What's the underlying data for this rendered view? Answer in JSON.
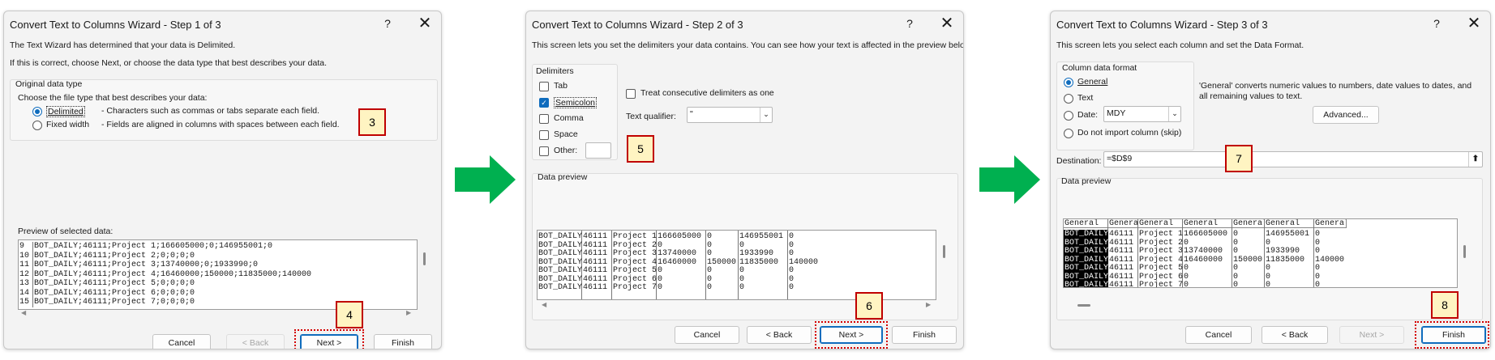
{
  "step1": {
    "title": "Convert Text to Columns Wizard - Step 1 of 3",
    "help": "?",
    "close": "✕",
    "intro1": "The Text Wizard has determined that your data is Delimited.",
    "intro2": "If this is correct, choose Next, or choose the data type that best describes your data.",
    "group_label": "Original data type",
    "choose_label": "Choose the file type that best describes your data:",
    "opt_delimited": "Delimited",
    "opt_delimited_desc": "- Characters such as commas or tabs separate each field.",
    "opt_fixed": "Fixed width",
    "opt_fixed_desc": "- Fields are aligned in columns with spaces between each field.",
    "preview_label": "Preview of selected data:",
    "preview_rows": [
      {
        "n": "9",
        "text": "BOT_DAILY;46111;Project 1;166605000;0;146955001;0"
      },
      {
        "n": "10",
        "text": "BOT_DAILY;46111;Project 2;0;0;0;0"
      },
      {
        "n": "11",
        "text": "BOT_DAILY;46111;Project 3;13740000;0;1933990;0"
      },
      {
        "n": "12",
        "text": "BOT_DAILY;46111;Project 4;16460000;150000;11835000;140000"
      },
      {
        "n": "13",
        "text": "BOT_DAILY;46111;Project 5;0;0;0;0"
      },
      {
        "n": "14",
        "text": "BOT_DAILY;46111;Project 6;0;0;0;0"
      },
      {
        "n": "15",
        "text": "BOT_DAILY;46111;Project 7;0;0;0;0"
      }
    ],
    "btn_cancel": "Cancel",
    "btn_back": "< Back",
    "btn_next": "Next >",
    "btn_finish": "Finish",
    "badge_group": "3",
    "badge_next": "4"
  },
  "step2": {
    "title": "Convert Text to Columns Wizard - Step 2 of 3",
    "help": "?",
    "close": "✕",
    "intro": "This screen lets you set the delimiters your data contains.  You can see how your text is affected in the preview below.",
    "delim_label": "Delimiters",
    "tab": "Tab",
    "semicolon": "Semicolon",
    "comma": "Comma",
    "space": "Space",
    "other": "Other:",
    "consecutive": "Treat consecutive delimiters as one",
    "qualifier_label": "Text qualifier:",
    "qualifier_value": "\"",
    "preview_label": "Data preview",
    "preview_rows": [
      [
        "BOT_DAILY",
        "46111",
        "Project 1",
        "166605000",
        "0",
        "146955001",
        "0"
      ],
      [
        "BOT_DAILY",
        "46111",
        "Project 2",
        "0",
        "0",
        "0",
        "0"
      ],
      [
        "BOT_DAILY",
        "46111",
        "Project 3",
        "13740000",
        "0",
        "1933990",
        "0"
      ],
      [
        "BOT_DAILY",
        "46111",
        "Project 4",
        "16460000",
        "150000",
        "11835000",
        "140000"
      ],
      [
        "BOT_DAILY",
        "46111",
        "Project 5",
        "0",
        "0",
        "0",
        "0"
      ],
      [
        "BOT_DAILY",
        "46111",
        "Project 6",
        "0",
        "0",
        "0",
        "0"
      ],
      [
        "BOT_DAILY",
        "46111",
        "Project 7",
        "0",
        "0",
        "0",
        "0"
      ]
    ],
    "btn_cancel": "Cancel",
    "btn_back": "< Back",
    "btn_next": "Next >",
    "btn_finish": "Finish",
    "badge_delims": "5",
    "badge_next": "6"
  },
  "step3": {
    "title": "Convert Text to Columns Wizard - Step 3 of 3",
    "help": "?",
    "close": "✕",
    "intro": "This screen lets you select each column and set the Data Format.",
    "format_label": "Column data format",
    "opt_general": "General",
    "opt_text": "Text",
    "opt_date": "Date:",
    "date_value": "MDY",
    "opt_skip": "Do not import column (skip)",
    "general_desc": "'General' converts numeric values to numbers, date values to dates, and all remaining values to text.",
    "advanced": "Advanced...",
    "destination_label": "Destination:",
    "destination_value": "=$D$9",
    "preview_label": "Data preview",
    "headers": [
      "General",
      "Genera",
      "General",
      "General",
      "General",
      "General",
      "General"
    ],
    "preview_rows": [
      [
        "BOT_DAILY",
        "46111",
        "Project 1",
        "166605000",
        "0",
        "146955001",
        "0"
      ],
      [
        "BOT_DAILY",
        "46111",
        "Project 2",
        "0",
        "0",
        "0",
        "0"
      ],
      [
        "BOT_DAILY",
        "46111",
        "Project 3",
        "13740000",
        "0",
        "1933990",
        "0"
      ],
      [
        "BOT_DAILY",
        "46111",
        "Project 4",
        "16460000",
        "150000",
        "11835000",
        "140000"
      ],
      [
        "BOT_DAILY",
        "46111",
        "Project 5",
        "0",
        "0",
        "0",
        "0"
      ],
      [
        "BOT_DAILY",
        "46111",
        "Project 6",
        "0",
        "0",
        "0",
        "0"
      ],
      [
        "BOT_DAILY",
        "46111",
        "Project 7",
        "0",
        "0",
        "0",
        "0"
      ]
    ],
    "btn_cancel": "Cancel",
    "btn_back": "< Back",
    "btn_next": "Next >",
    "btn_finish": "Finish",
    "badge_dest": "7",
    "badge_finish": "8"
  },
  "colors": {
    "arrow": "#00b050",
    "badge_border": "#c00000",
    "badge_fill": "#fff4c2",
    "highlight": "#d40000",
    "accent": "#0f6cbd"
  }
}
